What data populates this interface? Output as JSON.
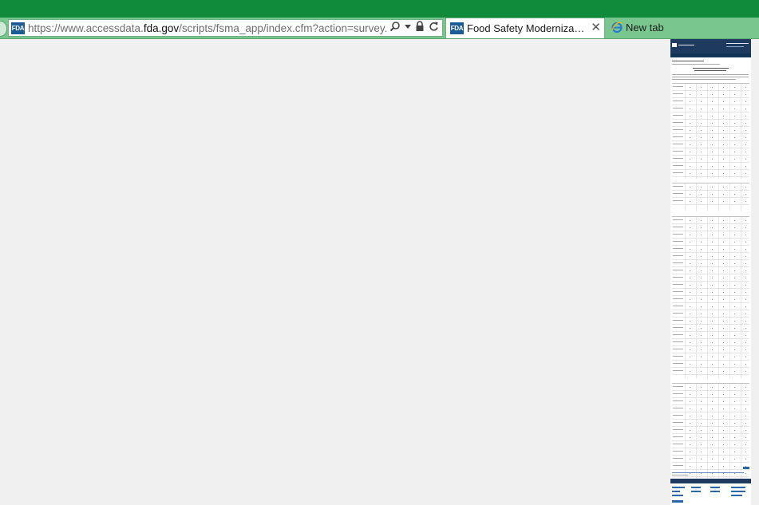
{
  "browser": {
    "address_bar": {
      "url_prefix": "https://www.accessdata.",
      "url_domain": "fda.gov",
      "url_path": "/scripts/fsma_app/index.cfm?action=survey.viewSun",
      "site_icon": "fda-favicon"
    },
    "tabs": [
      {
        "title": "Food Safety Modernization ...",
        "icon": "fda-favicon",
        "active": true,
        "close_symbol": "✕"
      },
      {
        "title": "New tab",
        "icon": "internet-explorer-icon",
        "active": false
      }
    ],
    "address_icons": [
      "search-icon",
      "dropdown-icon",
      "lock-icon",
      "refresh-icon"
    ],
    "favicon_text": "FDA"
  },
  "colors": {
    "titlebar": "#108a3b",
    "toolbar": "#79c78f",
    "page_background": "#f0f0f0",
    "fda_blue": "#1b5b96"
  }
}
